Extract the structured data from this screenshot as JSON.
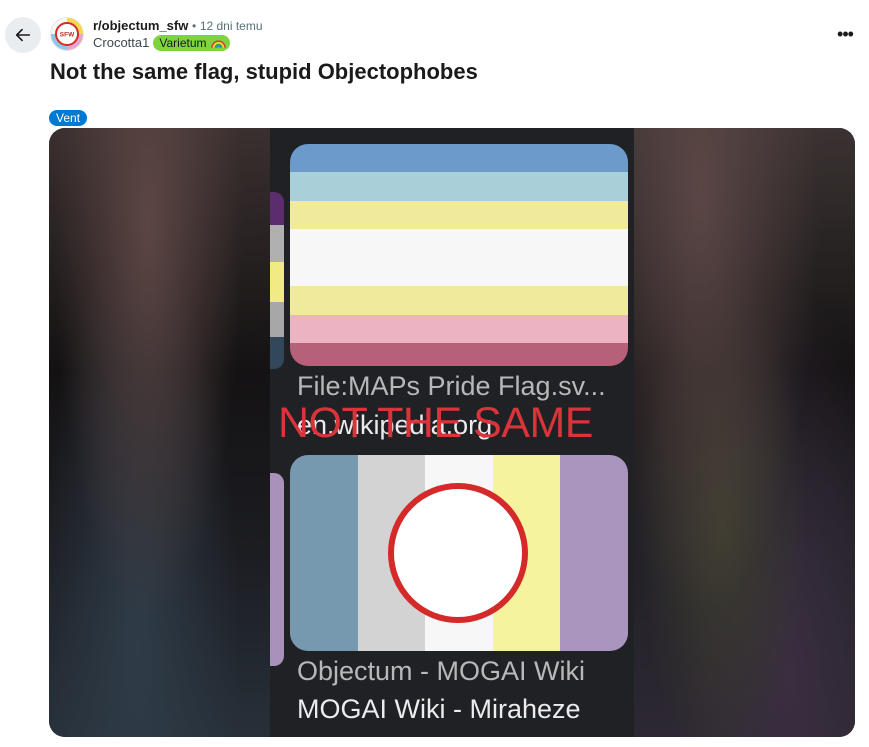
{
  "header": {
    "subreddit": "r/objectum_sfw",
    "separator": "•",
    "time": "12 dni temu",
    "author": "Crocotta1",
    "author_flair": "Varietum",
    "avatar_text": "SFW",
    "more_label": "•••"
  },
  "post": {
    "title": "Not the same flag, stupid Objectophobes",
    "flair": "Vent"
  },
  "image": {
    "results": [
      {
        "title": "File:MAPs Pride Flag.sv...",
        "source": "en.wikipedia.org",
        "stripes": [
          "#6b9acb",
          "#a9cfd9",
          "#f0eb9b",
          "#f7f7f7",
          "#f0eb9b",
          "#ecb3c2",
          "#b66079"
        ],
        "stripe_weights": [
          1,
          1,
          1,
          2,
          1,
          1,
          0.8
        ]
      },
      {
        "title": "Objectum - MOGAI Wiki",
        "source": "MOGAI Wiki - Miraheze",
        "stripes": [
          "#7799b0",
          "#d3d3d3",
          "#f7f7f7",
          "#f6f39f",
          "#a995bd"
        ]
      }
    ],
    "stamp_text": "NOT THE SAME"
  },
  "colors": {
    "post_flair_bg": "#0079d3",
    "author_flair_bg": "#7cd53f",
    "stamp_red": "#d8343a"
  }
}
